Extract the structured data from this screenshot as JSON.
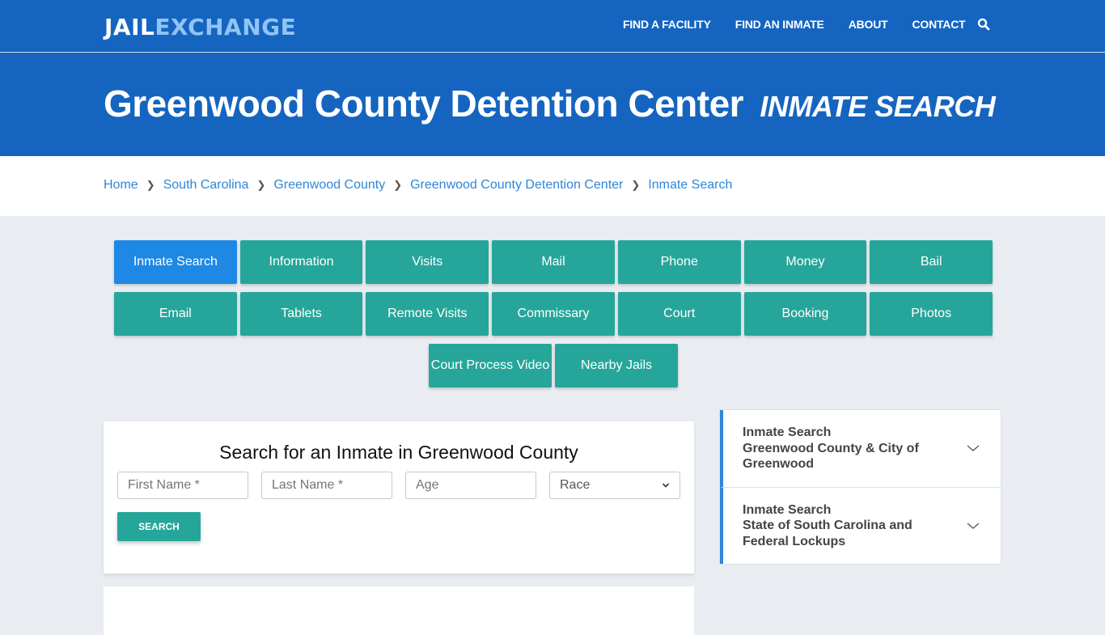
{
  "header": {
    "logo": {
      "part1": "JAIL",
      "part2": "EXCHANGE"
    },
    "nav": [
      {
        "label": "FIND A FACILITY"
      },
      {
        "label": "FIND AN INMATE"
      },
      {
        "label": "ABOUT"
      },
      {
        "label": "CONTACT"
      }
    ],
    "search_icon": "search-icon"
  },
  "hero": {
    "title": "Greenwood County Detention Center",
    "subtitle": "INMATE SEARCH"
  },
  "breadcrumb": [
    {
      "label": "Home"
    },
    {
      "label": "South Carolina"
    },
    {
      "label": "Greenwood County"
    },
    {
      "label": "Greenwood County Detention Center"
    },
    {
      "label": "Inmate Search"
    }
  ],
  "tiles": {
    "row1": [
      "Inmate Search",
      "Information",
      "Visits",
      "Mail",
      "Phone",
      "Money",
      "Bail"
    ],
    "row2": [
      "Email",
      "Tablets",
      "Remote Visits",
      "Commissary",
      "Court",
      "Booking",
      "Photos"
    ],
    "row3": [
      "Court Process Video",
      "Nearby Jails"
    ],
    "active": "Inmate Search"
  },
  "search_form": {
    "heading": "Search for an Inmate in Greenwood County",
    "first_name_placeholder": "First Name *",
    "last_name_placeholder": "Last Name *",
    "age_placeholder": "Age",
    "race_selected": "Race",
    "button": "SEARCH"
  },
  "sidebar": {
    "items": [
      {
        "line1": "Inmate Search",
        "line2": "Greenwood County & City of Greenwood"
      },
      {
        "line1": "Inmate Search",
        "line2": "State of South Carolina and Federal Lockups"
      }
    ]
  },
  "colors": {
    "primary": "#1565c0",
    "teal": "#26a69a",
    "active": "#1e88e5",
    "link": "#2f86d8"
  }
}
